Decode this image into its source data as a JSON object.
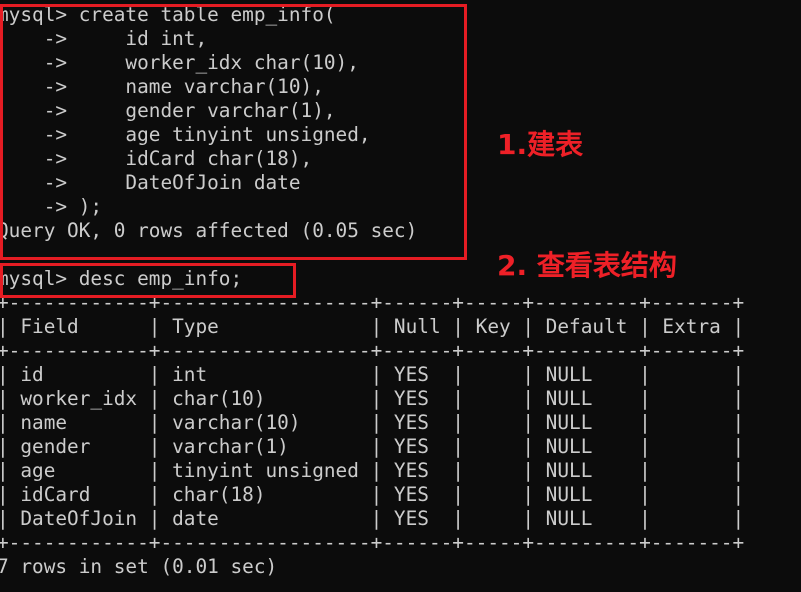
{
  "terminal": {
    "lines": [
      "mysql> create table emp_info(",
      "    ->     id int,",
      "    ->     worker_idx char(10),",
      "    ->     name varchar(10),",
      "    ->     gender varchar(1),",
      "    ->     age tinyint unsigned,",
      "    ->     idCard char(18),",
      "    ->     DateOfJoin date",
      "    -> );",
      "Query OK, 0 rows affected (0.05 sec)",
      "",
      "mysql> desc emp_info;",
      "+------------+------------------+------+-----+---------+-------+",
      "| Field      | Type             | Null | Key | Default | Extra |",
      "+------------+------------------+------+-----+---------+-------+",
      "| id         | int              | YES  |     | NULL    |       |",
      "| worker_idx | char(10)         | YES  |     | NULL    |       |",
      "| name       | varchar(10)      | YES  |     | NULL    |       |",
      "| gender     | varchar(1)       | YES  |     | NULL    |       |",
      "| age        | tinyint unsigned | YES  |     | NULL    |       |",
      "| idCard     | char(18)         | YES  |     | NULL    |       |",
      "| DateOfJoin | date             | YES  |     | NULL    |       |",
      "+------------+------------------+------+-----+---------+-------+",
      "7 rows in set (0.01 sec)"
    ]
  },
  "annotations": {
    "step1": "1.建表",
    "step2": "2. 查看表结构"
  },
  "colors": {
    "background": "#0c0c0c",
    "text": "#cccccc",
    "highlight": "#e51c23"
  }
}
